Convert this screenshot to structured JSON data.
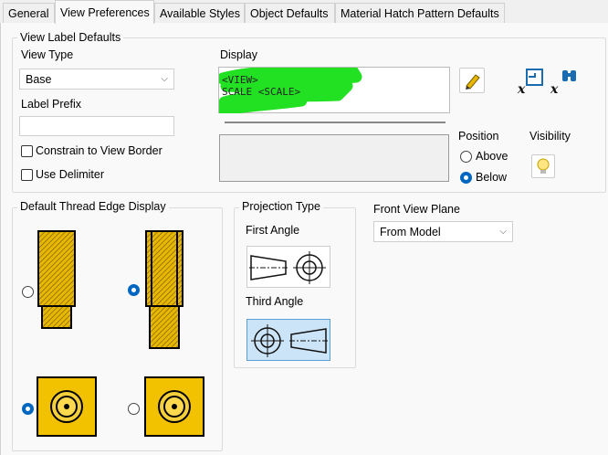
{
  "tabs": [
    {
      "label": "General"
    },
    {
      "label": "View Preferences"
    },
    {
      "label": "Available Styles"
    },
    {
      "label": "Object Defaults"
    },
    {
      "label": "Material Hatch Pattern Defaults"
    }
  ],
  "view_label_defaults": {
    "title": "View Label Defaults",
    "view_type_label": "View Type",
    "view_type_value": "Base",
    "label_prefix_label": "Label Prefix",
    "label_prefix_value": "",
    "constrain_label": "Constrain to View Border",
    "use_delimiter_label": "Use Delimiter",
    "display_label": "Display",
    "display_line1": "<VIEW>",
    "display_line2": "SCALE <SCALE>",
    "position_label": "Position",
    "above_label": "Above",
    "below_label": "Below",
    "visibility_label": "Visibility"
  },
  "thread": {
    "title": "Default Thread Edge Display"
  },
  "projection": {
    "title": "Projection Type",
    "first_angle_label": "First Angle",
    "third_angle_label": "Third Angle"
  },
  "front_view": {
    "label": "Front View Plane",
    "value": "From Model"
  },
  "colors": {
    "accent": "#0067c0",
    "highlight": "#22e022",
    "gold": "#e8b800",
    "selected_bg": "#cce4f7"
  }
}
